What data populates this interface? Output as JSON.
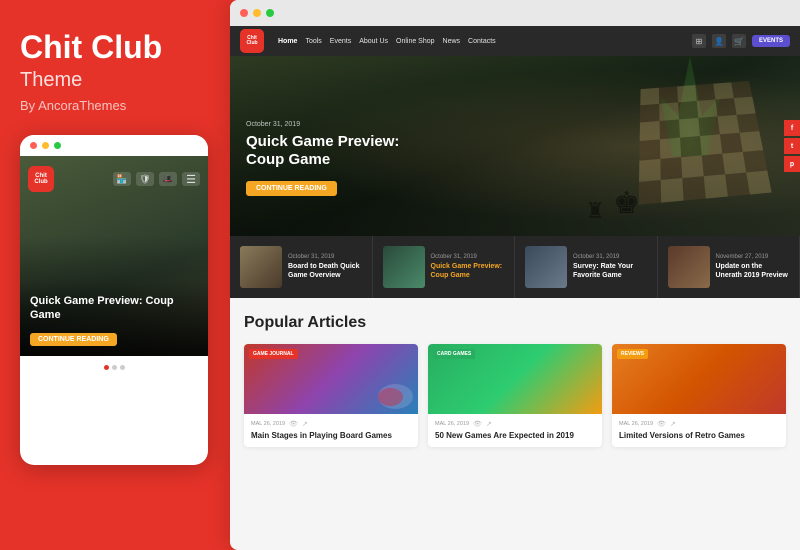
{
  "left": {
    "title": "Chit Club",
    "subtitle": "Theme",
    "by": "By AncoraThemes",
    "mobile_dots": [
      "red",
      "gray",
      "gray"
    ],
    "mobile_hero_title": "Quick Game Preview: Coup Game",
    "mobile_read_btn": "CONTINUE READING",
    "mobile_logo_line1": "Chit",
    "mobile_logo_line2": "Club"
  },
  "browser": {
    "dots": [
      {
        "color": "#ff5f57"
      },
      {
        "color": "#ffbd2e"
      },
      {
        "color": "#28ca41"
      }
    ]
  },
  "navbar": {
    "logo_line1": "Chit",
    "logo_line2": "Club",
    "links": [
      {
        "label": "Home",
        "active": true
      },
      {
        "label": "Tools"
      },
      {
        "label": "Events"
      },
      {
        "label": "About Us"
      },
      {
        "label": "Online Shop"
      },
      {
        "label": "News"
      },
      {
        "label": "Contacts"
      }
    ],
    "events_btn": "EVENTS"
  },
  "hero": {
    "date": "October 31, 2019",
    "title": "Quick Game Preview: Coup Game",
    "read_btn": "CONTINUE READING",
    "side_icons": [
      "f",
      "t",
      "p"
    ]
  },
  "posts_strip": [
    {
      "date": "October 31, 2019",
      "title": "Board to Death Quick Game Overview",
      "highlight": false
    },
    {
      "date": "October 31, 2019",
      "title": "Quick Game Preview: Coup Game",
      "highlight": true
    },
    {
      "date": "October 31, 2019",
      "title": "Survey: Rate Your Favorite Game",
      "highlight": false
    },
    {
      "date": "November 27, 2019",
      "title": "Update on the Unerath 2019 Preview",
      "highlight": false
    }
  ],
  "popular_articles": {
    "section_title": "Popular Articles",
    "articles": [
      {
        "tag": "GAME JOURNAL",
        "tag_class": "tag-game-journal",
        "img_class": "article-img-chips",
        "date": "MAL 26, 2019",
        "title": "Main Stages in Playing Board Games"
      },
      {
        "tag": "CARD GAMES",
        "tag_class": "tag-card-games",
        "img_class": "article-img-board-game",
        "date": "MAL 26, 2019",
        "title": "50 New Games Are Expected in 2019"
      },
      {
        "tag": "REVIEWS",
        "tag_class": "tag-reviews",
        "img_class": "article-img-retro",
        "date": "MAL 26, 2019",
        "title": "Limited Versions of Retro Games"
      }
    ]
  }
}
